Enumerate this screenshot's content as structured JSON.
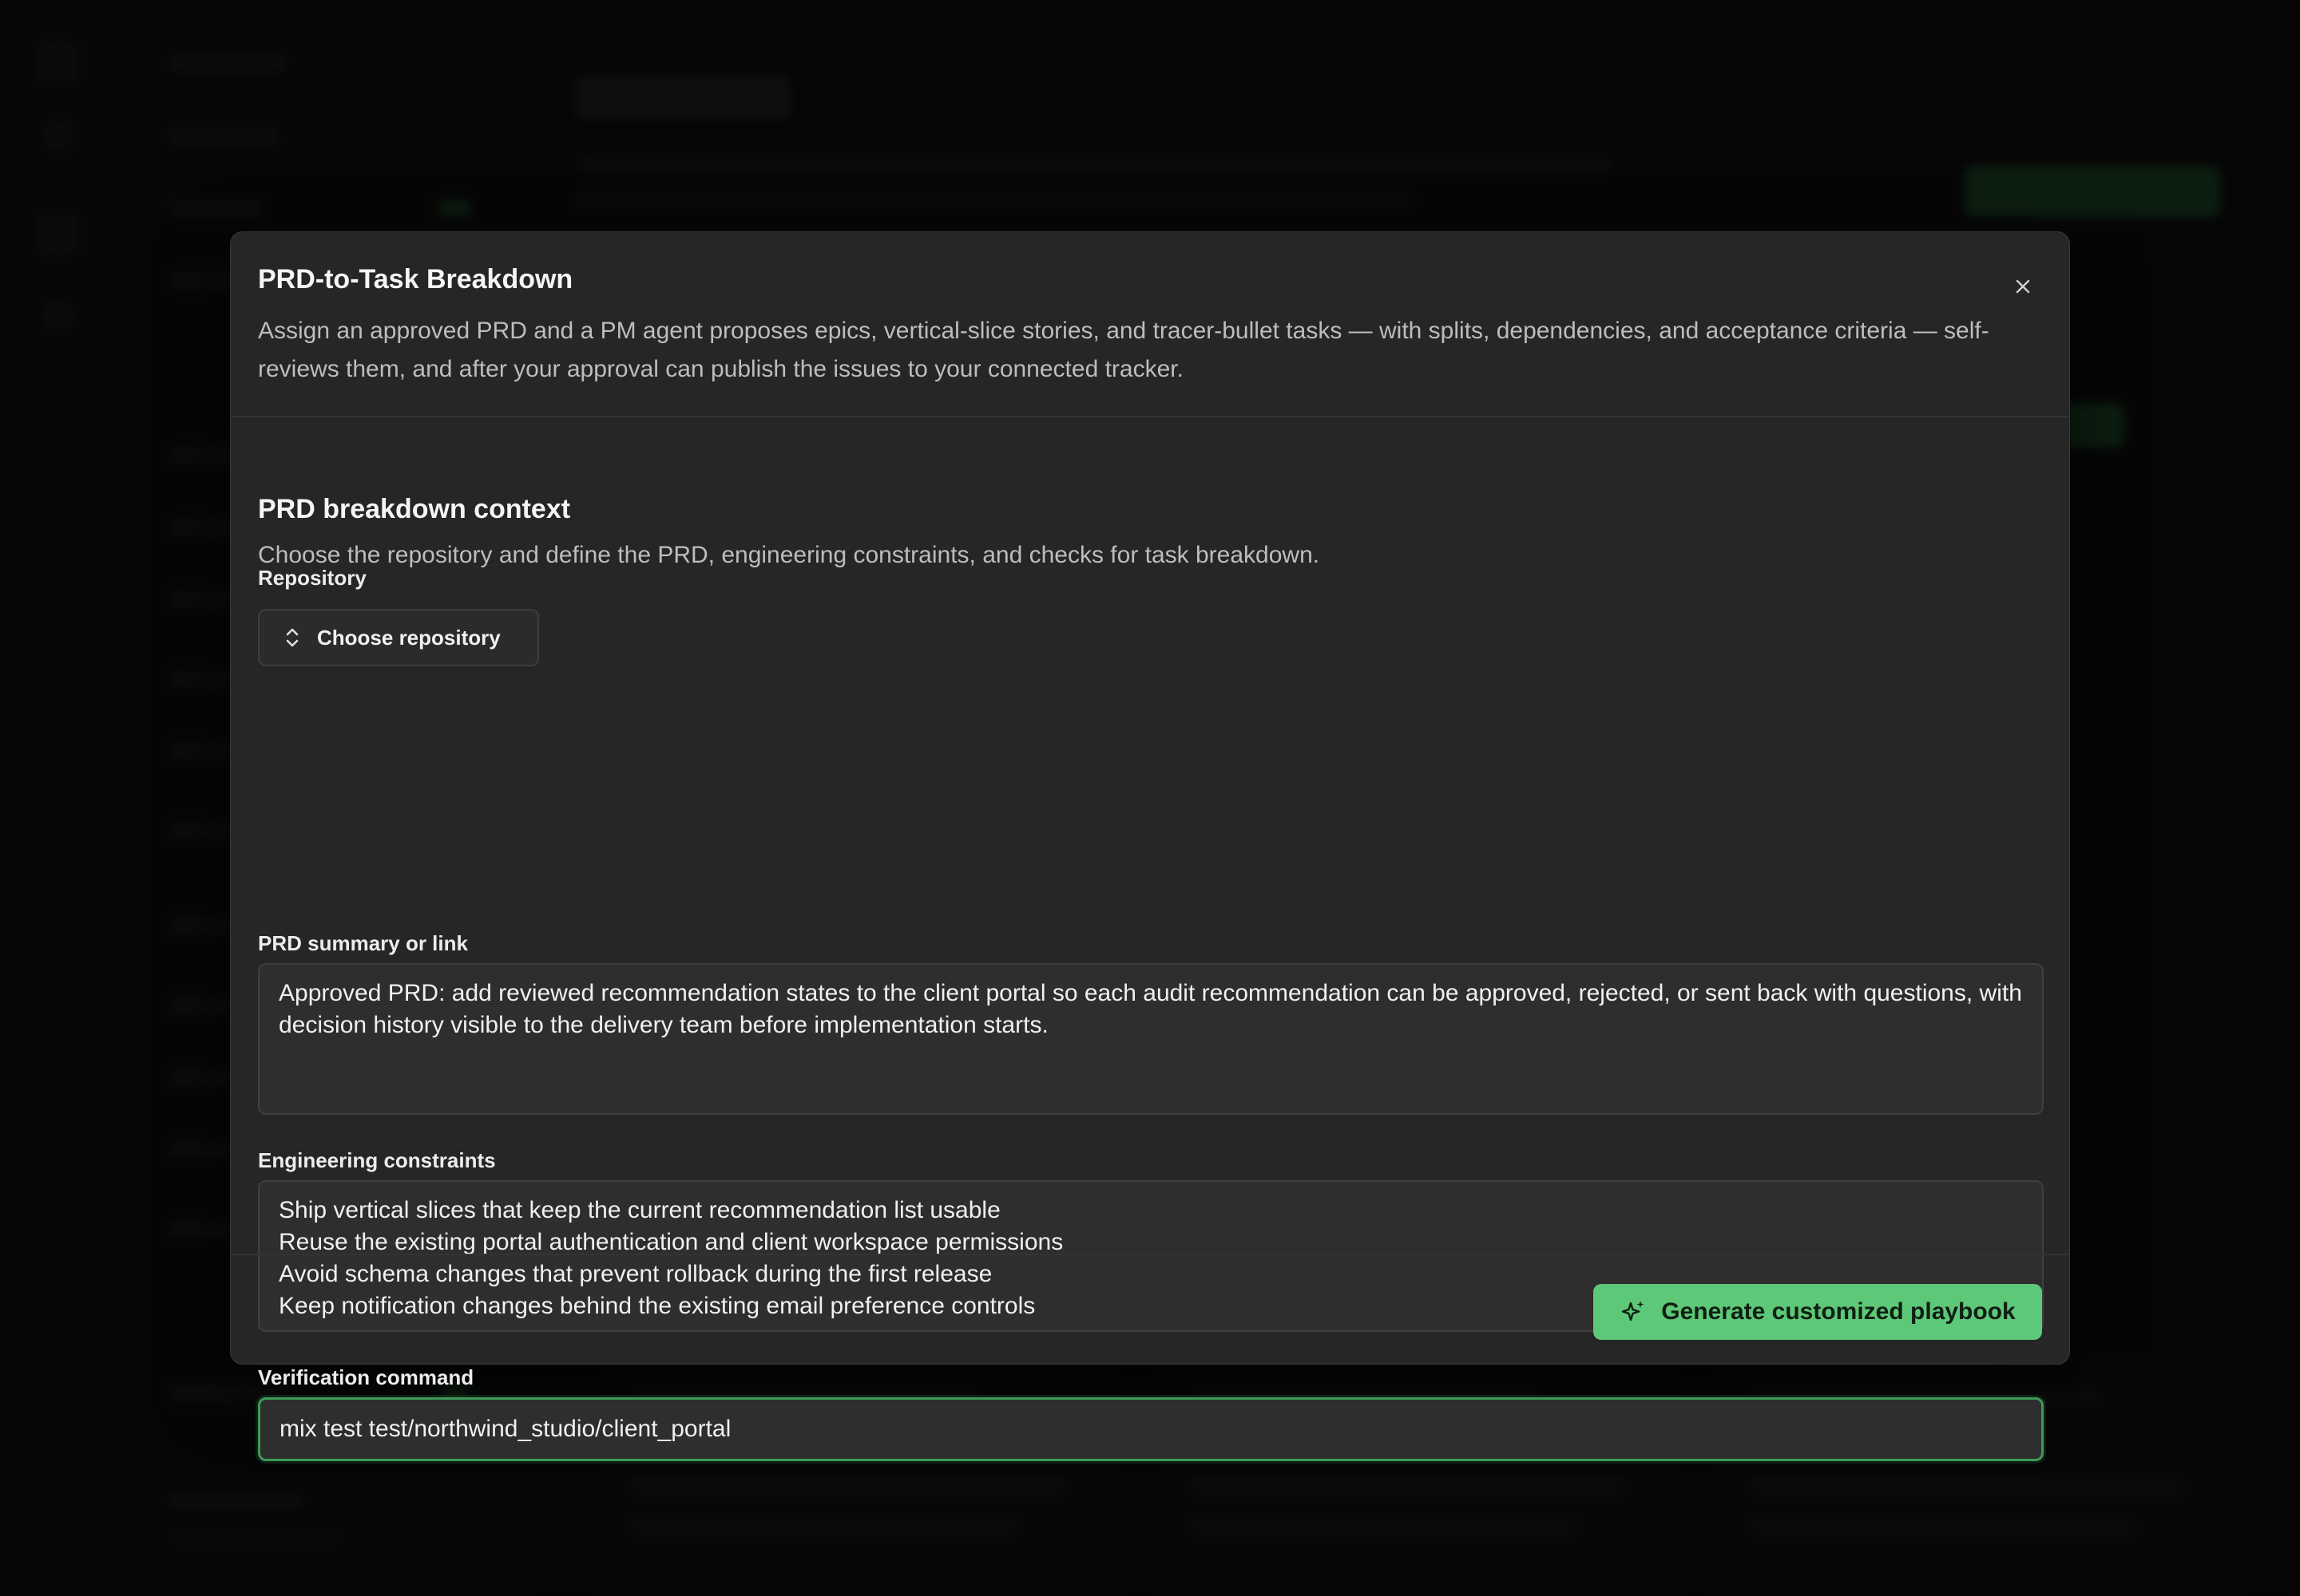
{
  "modal": {
    "title": "PRD-to-Task Breakdown",
    "description": "Assign an approved PRD and a PM agent proposes epics, vertical-slice stories, and tracer-bullet tasks — with splits, dependencies, and acceptance criteria — self-reviews them, and after your approval can publish the issues to your connected tracker.",
    "close_icon": "close-icon"
  },
  "section": {
    "title": "PRD breakdown context",
    "description": "Choose the repository and define the PRD, engineering constraints, and checks for task breakdown."
  },
  "repository": {
    "label": "Repository",
    "button_label": "Choose repository",
    "icon": "chevron-up-down-icon"
  },
  "prd": {
    "label": "PRD summary or link",
    "value": "Approved PRD: add reviewed recommendation states to the client portal so each audit recommendation can be approved, rejected, or sent back with questions, with decision history visible to the delivery team before implementation starts."
  },
  "constraints": {
    "label": "Engineering constraints",
    "value": "Ship vertical slices that keep the current recommendation list usable\nReuse the existing portal authentication and client workspace permissions\nAvoid schema changes that prevent rollback during the first release\nKeep notification changes behind the existing email preference controls"
  },
  "verification": {
    "label": "Verification command",
    "value": "mix test test/northwind_studio/client_portal"
  },
  "footer": {
    "generate_label": "Generate customized playbook",
    "generate_icon": "sparkles-icon"
  },
  "colors": {
    "accent": "#5ec879",
    "focus": "#3d9a58",
    "modal_bg": "#262626"
  }
}
